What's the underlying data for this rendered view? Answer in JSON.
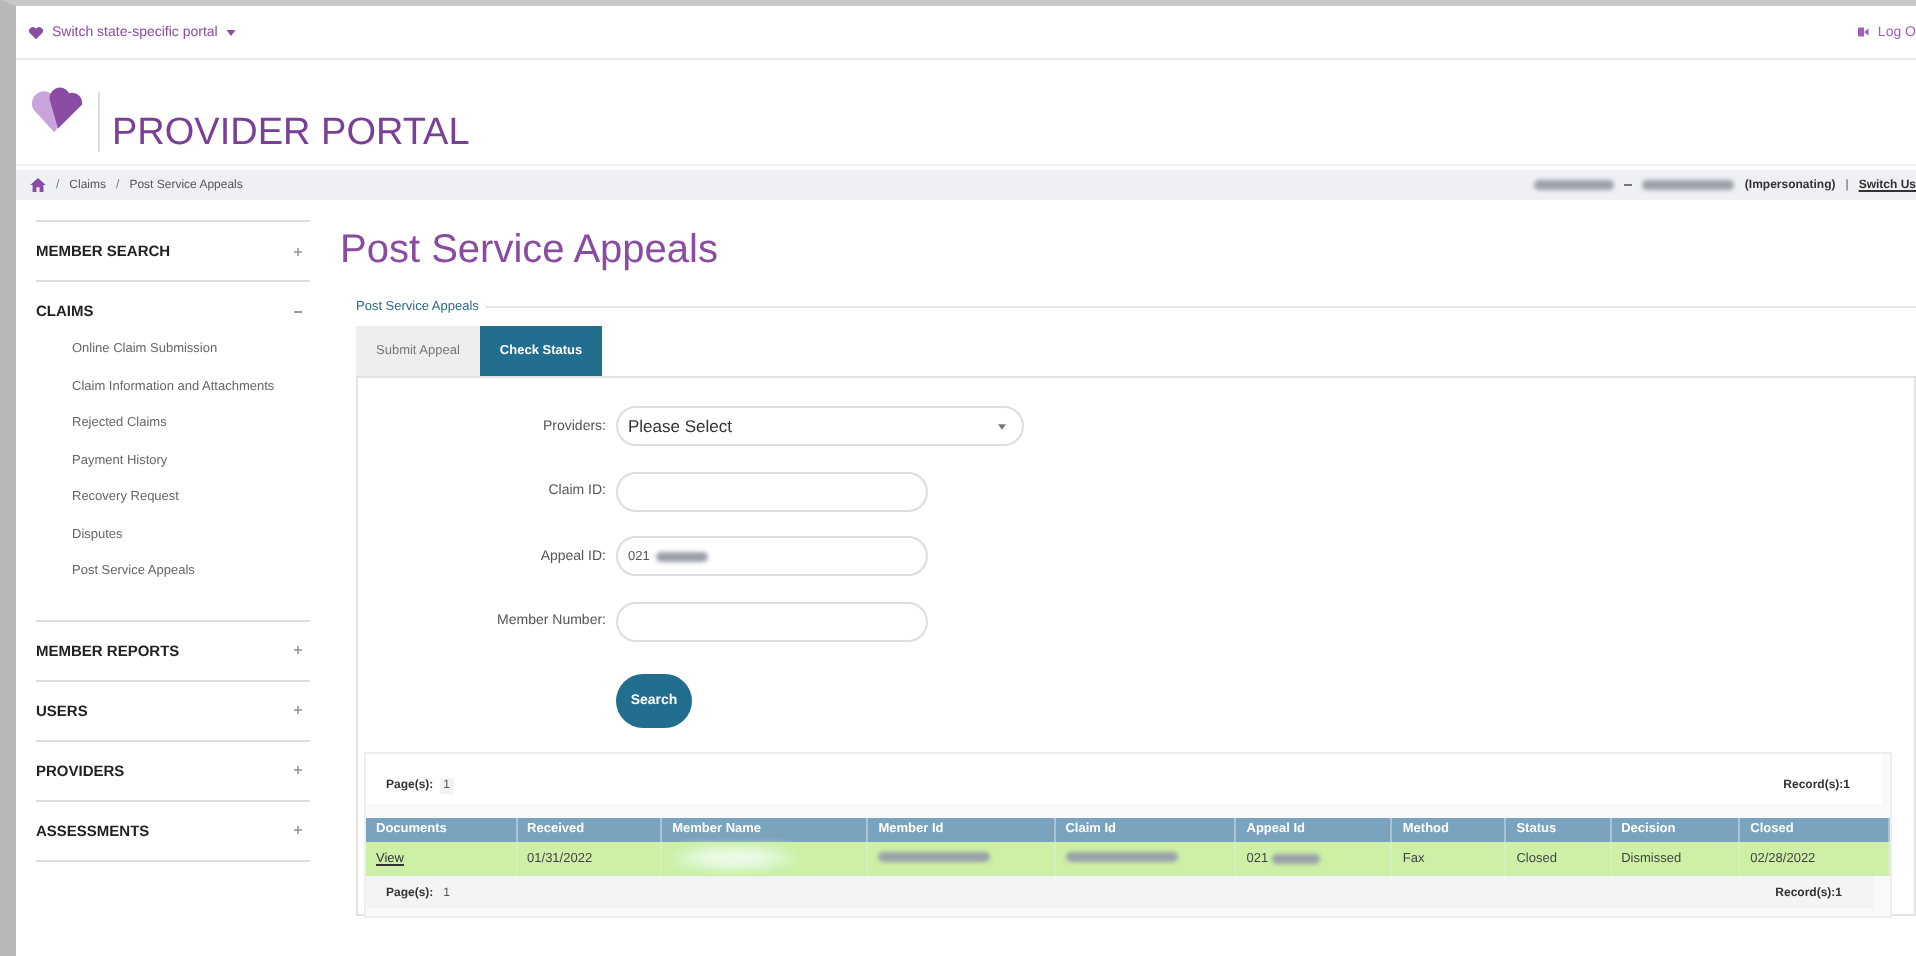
{
  "top_bar": {
    "portal_switch": "Switch state-specific portal",
    "logout": "Log O"
  },
  "header": {
    "title": "PROVIDER PORTAL"
  },
  "breadcrumb": {
    "items": [
      {
        "separator": "/",
        "label": "Claims"
      },
      {
        "separator": "/",
        "label": "Post Service Appeals"
      }
    ],
    "impersonating": "(Impersonating)",
    "separator": "|",
    "switch_user": "Switch Us"
  },
  "sidebar": {
    "sections": [
      {
        "label": "MEMBER SEARCH",
        "expanded": false
      },
      {
        "label": "CLAIMS",
        "expanded": true,
        "children": [
          "Online Claim Submission",
          "Claim Information and Attachments",
          "Rejected Claims",
          "Payment History",
          "Recovery Request",
          "Disputes",
          "Post Service Appeals"
        ]
      },
      {
        "label": "MEMBER REPORTS",
        "expanded": false
      },
      {
        "label": "USERS",
        "expanded": false
      },
      {
        "label": "PROVIDERS",
        "expanded": false
      },
      {
        "label": "ASSESSMENTS",
        "expanded": false
      }
    ]
  },
  "page_title": "Post Service Appeals",
  "panel_legend": "Post Service Appeals",
  "tabs": [
    {
      "label": "Submit Appeal",
      "selected": false
    },
    {
      "label": "Check Status",
      "selected": true
    }
  ],
  "form": {
    "fields": [
      {
        "label": "Providers:",
        "kind": "select",
        "value": "Please Select"
      },
      {
        "label": "Claim ID:",
        "kind": "text"
      },
      {
        "label": "Appeal ID:",
        "kind": "masked",
        "value": "021"
      },
      {
        "label": "Member Number:",
        "kind": "text"
      }
    ],
    "submit": "Search"
  },
  "results": {
    "top_pager": {
      "pages_label": "Page(s):",
      "page": "1",
      "records": "Record(s):1"
    },
    "columns": [
      "Documents",
      "Received",
      "Member Name",
      "Member Id",
      "Claim Id",
      "Appeal Id",
      "Method",
      "Status",
      "Decision",
      "Closed"
    ],
    "rows": [
      {
        "highlighted": true,
        "cells": [
          {
            "kind": "link",
            "text": "View"
          },
          {
            "kind": "text",
            "text": "01/31/2022"
          },
          {
            "kind": "blur"
          },
          {
            "kind": "blur"
          },
          {
            "kind": "blur"
          },
          {
            "kind": "partial",
            "text": "021"
          },
          {
            "kind": "text",
            "text": "Fax"
          },
          {
            "kind": "text",
            "text": "Closed"
          },
          {
            "kind": "text",
            "text": "Dismissed"
          },
          {
            "kind": "text",
            "text": "02/28/2022"
          }
        ]
      }
    ],
    "bottom_pager": {
      "pages_label": "Page(s):",
      "page": "1",
      "records": "Record(s):1"
    }
  }
}
